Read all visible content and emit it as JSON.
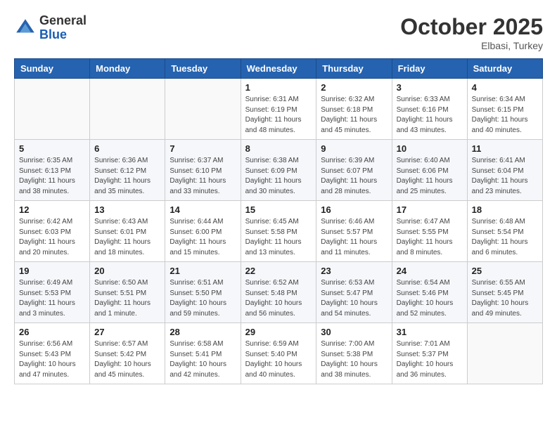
{
  "logo": {
    "general": "General",
    "blue": "Blue"
  },
  "header": {
    "month": "October 2025",
    "location": "Elbasi, Turkey"
  },
  "weekdays": [
    "Sunday",
    "Monday",
    "Tuesday",
    "Wednesday",
    "Thursday",
    "Friday",
    "Saturday"
  ],
  "weeks": [
    [
      {
        "day": "",
        "detail": ""
      },
      {
        "day": "",
        "detail": ""
      },
      {
        "day": "",
        "detail": ""
      },
      {
        "day": "1",
        "detail": "Sunrise: 6:31 AM\nSunset: 6:19 PM\nDaylight: 11 hours\nand 48 minutes."
      },
      {
        "day": "2",
        "detail": "Sunrise: 6:32 AM\nSunset: 6:18 PM\nDaylight: 11 hours\nand 45 minutes."
      },
      {
        "day": "3",
        "detail": "Sunrise: 6:33 AM\nSunset: 6:16 PM\nDaylight: 11 hours\nand 43 minutes."
      },
      {
        "day": "4",
        "detail": "Sunrise: 6:34 AM\nSunset: 6:15 PM\nDaylight: 11 hours\nand 40 minutes."
      }
    ],
    [
      {
        "day": "5",
        "detail": "Sunrise: 6:35 AM\nSunset: 6:13 PM\nDaylight: 11 hours\nand 38 minutes."
      },
      {
        "day": "6",
        "detail": "Sunrise: 6:36 AM\nSunset: 6:12 PM\nDaylight: 11 hours\nand 35 minutes."
      },
      {
        "day": "7",
        "detail": "Sunrise: 6:37 AM\nSunset: 6:10 PM\nDaylight: 11 hours\nand 33 minutes."
      },
      {
        "day": "8",
        "detail": "Sunrise: 6:38 AM\nSunset: 6:09 PM\nDaylight: 11 hours\nand 30 minutes."
      },
      {
        "day": "9",
        "detail": "Sunrise: 6:39 AM\nSunset: 6:07 PM\nDaylight: 11 hours\nand 28 minutes."
      },
      {
        "day": "10",
        "detail": "Sunrise: 6:40 AM\nSunset: 6:06 PM\nDaylight: 11 hours\nand 25 minutes."
      },
      {
        "day": "11",
        "detail": "Sunrise: 6:41 AM\nSunset: 6:04 PM\nDaylight: 11 hours\nand 23 minutes."
      }
    ],
    [
      {
        "day": "12",
        "detail": "Sunrise: 6:42 AM\nSunset: 6:03 PM\nDaylight: 11 hours\nand 20 minutes."
      },
      {
        "day": "13",
        "detail": "Sunrise: 6:43 AM\nSunset: 6:01 PM\nDaylight: 11 hours\nand 18 minutes."
      },
      {
        "day": "14",
        "detail": "Sunrise: 6:44 AM\nSunset: 6:00 PM\nDaylight: 11 hours\nand 15 minutes."
      },
      {
        "day": "15",
        "detail": "Sunrise: 6:45 AM\nSunset: 5:58 PM\nDaylight: 11 hours\nand 13 minutes."
      },
      {
        "day": "16",
        "detail": "Sunrise: 6:46 AM\nSunset: 5:57 PM\nDaylight: 11 hours\nand 11 minutes."
      },
      {
        "day": "17",
        "detail": "Sunrise: 6:47 AM\nSunset: 5:55 PM\nDaylight: 11 hours\nand 8 minutes."
      },
      {
        "day": "18",
        "detail": "Sunrise: 6:48 AM\nSunset: 5:54 PM\nDaylight: 11 hours\nand 6 minutes."
      }
    ],
    [
      {
        "day": "19",
        "detail": "Sunrise: 6:49 AM\nSunset: 5:53 PM\nDaylight: 11 hours\nand 3 minutes."
      },
      {
        "day": "20",
        "detail": "Sunrise: 6:50 AM\nSunset: 5:51 PM\nDaylight: 11 hours\nand 1 minute."
      },
      {
        "day": "21",
        "detail": "Sunrise: 6:51 AM\nSunset: 5:50 PM\nDaylight: 10 hours\nand 59 minutes."
      },
      {
        "day": "22",
        "detail": "Sunrise: 6:52 AM\nSunset: 5:48 PM\nDaylight: 10 hours\nand 56 minutes."
      },
      {
        "day": "23",
        "detail": "Sunrise: 6:53 AM\nSunset: 5:47 PM\nDaylight: 10 hours\nand 54 minutes."
      },
      {
        "day": "24",
        "detail": "Sunrise: 6:54 AM\nSunset: 5:46 PM\nDaylight: 10 hours\nand 52 minutes."
      },
      {
        "day": "25",
        "detail": "Sunrise: 6:55 AM\nSunset: 5:45 PM\nDaylight: 10 hours\nand 49 minutes."
      }
    ],
    [
      {
        "day": "26",
        "detail": "Sunrise: 6:56 AM\nSunset: 5:43 PM\nDaylight: 10 hours\nand 47 minutes."
      },
      {
        "day": "27",
        "detail": "Sunrise: 6:57 AM\nSunset: 5:42 PM\nDaylight: 10 hours\nand 45 minutes."
      },
      {
        "day": "28",
        "detail": "Sunrise: 6:58 AM\nSunset: 5:41 PM\nDaylight: 10 hours\nand 42 minutes."
      },
      {
        "day": "29",
        "detail": "Sunrise: 6:59 AM\nSunset: 5:40 PM\nDaylight: 10 hours\nand 40 minutes."
      },
      {
        "day": "30",
        "detail": "Sunrise: 7:00 AM\nSunset: 5:38 PM\nDaylight: 10 hours\nand 38 minutes."
      },
      {
        "day": "31",
        "detail": "Sunrise: 7:01 AM\nSunset: 5:37 PM\nDaylight: 10 hours\nand 36 minutes."
      },
      {
        "day": "",
        "detail": ""
      }
    ]
  ]
}
